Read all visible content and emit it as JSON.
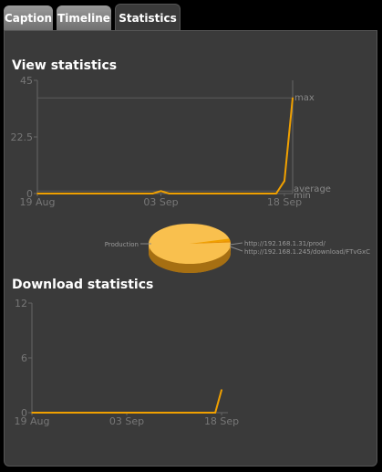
{
  "tabs": [
    {
      "label": "Caption"
    },
    {
      "label": "Timeline"
    },
    {
      "label": "Statistics",
      "active": true
    }
  ],
  "view_stats": {
    "title": "View statistics",
    "marker_labels": {
      "max": "max",
      "average": "average",
      "min": "min"
    }
  },
  "pie": {
    "labels": {
      "production": "Production",
      "url1": "http://192.168.1.31/prod/",
      "url2": "http://192.168.1.245/download/FTvGxC"
    }
  },
  "download_stats": {
    "title": "Download statistics"
  },
  "colors": {
    "accent": "#f0a000",
    "pie": "#f9c04e",
    "panel": "#3a3a3a",
    "grid": "#5a5a5a"
  },
  "chart_data": [
    {
      "type": "line",
      "xlabels": [
        "19 Aug",
        "03 Sep",
        "18 Sep"
      ],
      "yticks": [
        "45",
        "22.5",
        "0"
      ],
      "ylim": [
        0,
        45
      ],
      "x": [
        0,
        14,
        15,
        16,
        29,
        30,
        31
      ],
      "values": [
        0,
        0,
        1,
        0,
        0,
        5,
        38
      ],
      "max": 38,
      "average": 1,
      "min": 0
    },
    {
      "type": "pie",
      "slices": [
        {
          "label": "Production",
          "value": 97
        },
        {
          "label": "http://192.168.1.31/prod/",
          "value": 2
        },
        {
          "label": "http://192.168.1.245/download/FTvGxC",
          "value": 1
        }
      ]
    },
    {
      "type": "line",
      "xlabels": [
        "19 Aug",
        "03 Sep",
        "18 Sep"
      ],
      "yticks": [
        "12",
        "6",
        "0"
      ],
      "ylim": [
        0,
        12
      ],
      "x": [
        0,
        29,
        30
      ],
      "values": [
        0,
        0,
        2.5
      ]
    }
  ]
}
